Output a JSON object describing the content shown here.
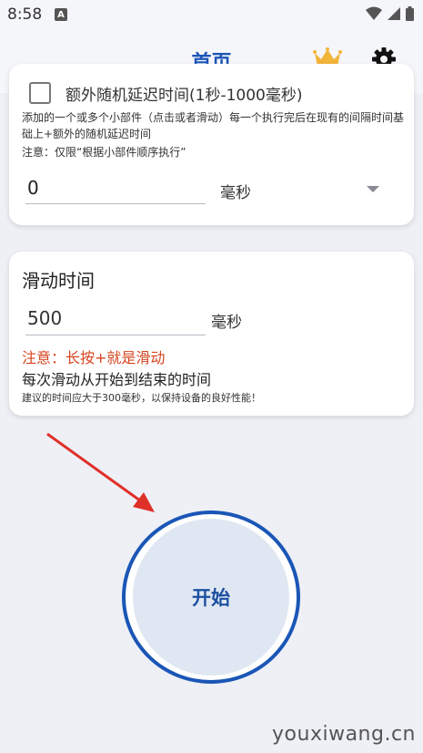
{
  "status_bar": {
    "time": "8:58",
    "notification_icon": "A"
  },
  "header": {
    "title": "首页"
  },
  "card1": {
    "checkbox_label": "额外随机延迟时间(1秒-1000毫秒)",
    "description": "添加的一个或多个小部件（点击或者滑动）每一个执行完后在现有的间隔时间基础上+额外的随机延迟时间",
    "note": "注意：仅限“根据小部件顺序执行”",
    "value": "0",
    "unit": "毫秒"
  },
  "card2": {
    "title": "滑动时间",
    "value": "500",
    "unit": "毫秒",
    "warning": "注意：长按+就是滑动",
    "info": "每次滑动从开始到结束的时间",
    "small_note": "建议的时间应大于300毫秒，以保持设备的良好性能！"
  },
  "start_button": {
    "label": "开始"
  },
  "watermark": "youxiwang.cn",
  "colors": {
    "accent": "#1b56b8",
    "warning": "#d64520",
    "arrow": "#e0302a"
  },
  "icons": [
    "wifi-icon",
    "signal-icon",
    "battery-icon",
    "crown-icon",
    "gear-icon"
  ]
}
